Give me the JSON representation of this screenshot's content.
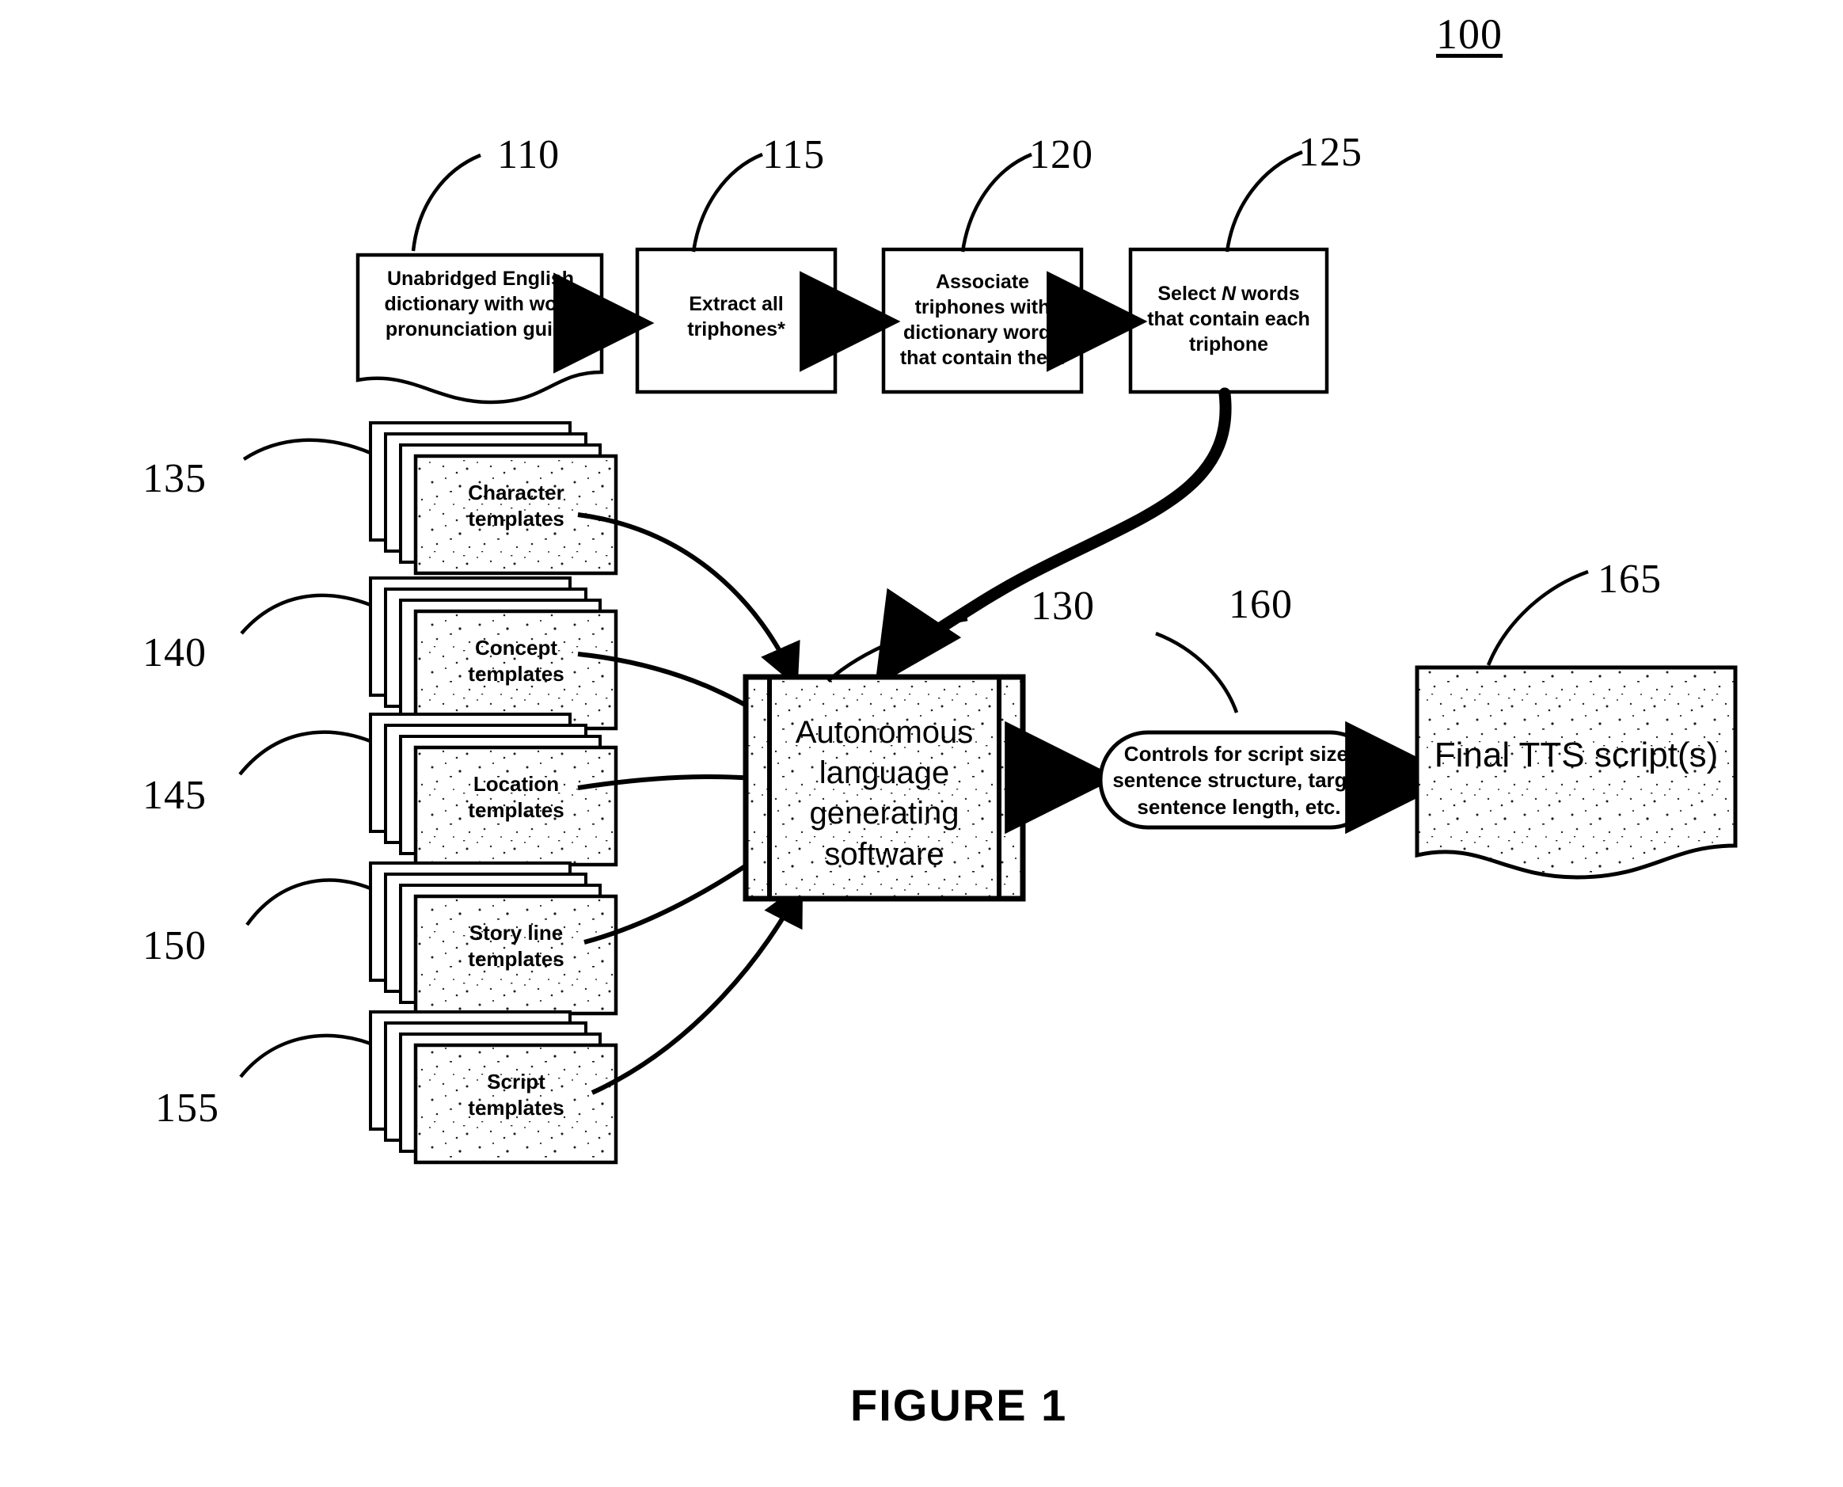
{
  "figure": {
    "system_ref": "100",
    "caption": "FIGURE 1"
  },
  "nodes": {
    "dictionary": {
      "ref": "110",
      "label": "Unabridged English\ndictionary with word\npronunciation guide",
      "shape": "document"
    },
    "extract": {
      "ref": "115",
      "label": "Extract all\ntriphones*",
      "shape": "process"
    },
    "associate": {
      "ref": "120",
      "label": "Associate\ntriphones with\ndictionary words\nthat contain them",
      "shape": "process"
    },
    "select": {
      "ref": "125",
      "label_pre": "Select ",
      "label_em": "N",
      "label_post": " words\nthat contain each\ntriphone",
      "label": "Select N words\nthat contain each\ntriphone",
      "shape": "process"
    },
    "software": {
      "ref": "130",
      "label": "Autonomous\nlanguage\ngenerating\nsoftware",
      "shape": "predefined-process"
    },
    "controls": {
      "ref": "160",
      "label": "Controls for script size,\nsentence structure, target\nsentence length, etc.",
      "shape": "stadium"
    },
    "output": {
      "ref": "165",
      "label": "Final TTS script(s)",
      "shape": "document"
    }
  },
  "template_stacks": [
    {
      "ref": "135",
      "label": "Character\ntemplates"
    },
    {
      "ref": "140",
      "label": "Concept\ntemplates"
    },
    {
      "ref": "145",
      "label": "Location\ntemplates"
    },
    {
      "ref": "150",
      "label": "Story line\ntemplates"
    },
    {
      "ref": "155",
      "label": "Script\ntemplates"
    }
  ],
  "colors": {
    "stroke": "#000000",
    "fill": "#ffffff",
    "background": "#ffffff"
  }
}
